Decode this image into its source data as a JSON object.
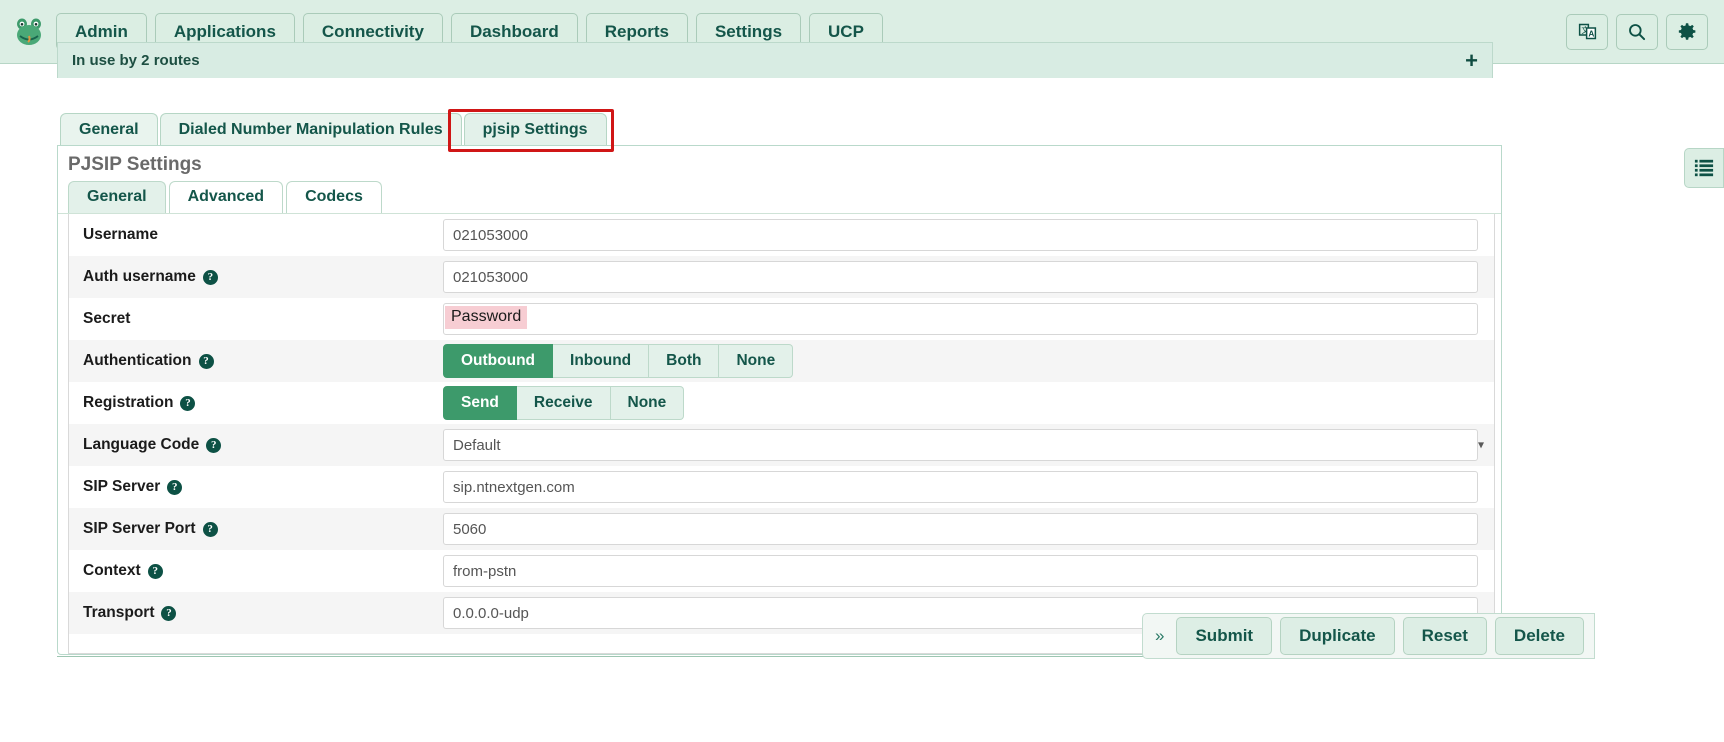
{
  "topbar": {
    "logo_icon": "freepbx-frog-logo",
    "nav_items": [
      {
        "label": "Admin",
        "name": "nav-admin"
      },
      {
        "label": "Applications",
        "name": "nav-applications"
      },
      {
        "label": "Connectivity",
        "name": "nav-connectivity"
      },
      {
        "label": "Dashboard",
        "name": "nav-dashboard"
      },
      {
        "label": "Reports",
        "name": "nav-reports"
      },
      {
        "label": "Settings",
        "name": "nav-settings"
      },
      {
        "label": "UCP",
        "name": "nav-ucp"
      }
    ],
    "right_icons": [
      {
        "name": "translate-icon",
        "title": "Language"
      },
      {
        "name": "search-icon",
        "title": "Search"
      },
      {
        "name": "gear-icon",
        "title": "Settings"
      }
    ]
  },
  "inuse": {
    "text": "In use by 2 routes",
    "plus_label": "+"
  },
  "tabs": [
    {
      "label": "General",
      "active": false
    },
    {
      "label": "Dialed Number Manipulation Rules",
      "active": false
    },
    {
      "label": "pjsip Settings",
      "active": true
    }
  ],
  "panel": {
    "title": "PJSIP Settings",
    "subtabs": [
      {
        "label": "General",
        "active": true
      },
      {
        "label": "Advanced",
        "active": false
      },
      {
        "label": "Codecs",
        "active": false
      }
    ]
  },
  "form": {
    "rows": [
      {
        "label": "Username",
        "help": false,
        "type": "text",
        "value": "021053000"
      },
      {
        "label": "Auth username",
        "help": true,
        "type": "text",
        "value": "021053000"
      },
      {
        "label": "Secret",
        "help": false,
        "type": "secret",
        "value": "Password",
        "highlight_color": "#f7cdd3"
      },
      {
        "label": "Authentication",
        "help": true,
        "type": "buttons",
        "options": [
          "Outbound",
          "Inbound",
          "Both",
          "None"
        ],
        "selected": "Outbound"
      },
      {
        "label": "Registration",
        "help": true,
        "type": "buttons",
        "options": [
          "Send",
          "Receive",
          "None"
        ],
        "selected": "Send"
      },
      {
        "label": "Language Code",
        "help": true,
        "type": "select",
        "value": "Default",
        "options": [
          "Default"
        ]
      },
      {
        "label": "SIP Server",
        "help": true,
        "type": "text",
        "value": "sip.ntnextgen.com"
      },
      {
        "label": "SIP Server Port",
        "help": true,
        "type": "text",
        "value": "5060"
      },
      {
        "label": "Context",
        "help": true,
        "type": "text",
        "value": "from-pstn"
      },
      {
        "label": "Transport",
        "help": true,
        "type": "text",
        "value": "0.0.0.0-udp"
      }
    ]
  },
  "actionbar": {
    "expand_label": "»",
    "buttons": [
      {
        "label": "Submit"
      },
      {
        "label": "Duplicate"
      },
      {
        "label": "Reset"
      },
      {
        "label": "Delete"
      }
    ]
  },
  "side_toggle": {
    "icon": "list-icon"
  },
  "colors": {
    "brand_green": "#14564a",
    "accent_green": "#3d9a6b",
    "nav_bg": "#dceee4",
    "highlight_red": "#d01616",
    "secret_highlight": "#f7cdd3"
  }
}
